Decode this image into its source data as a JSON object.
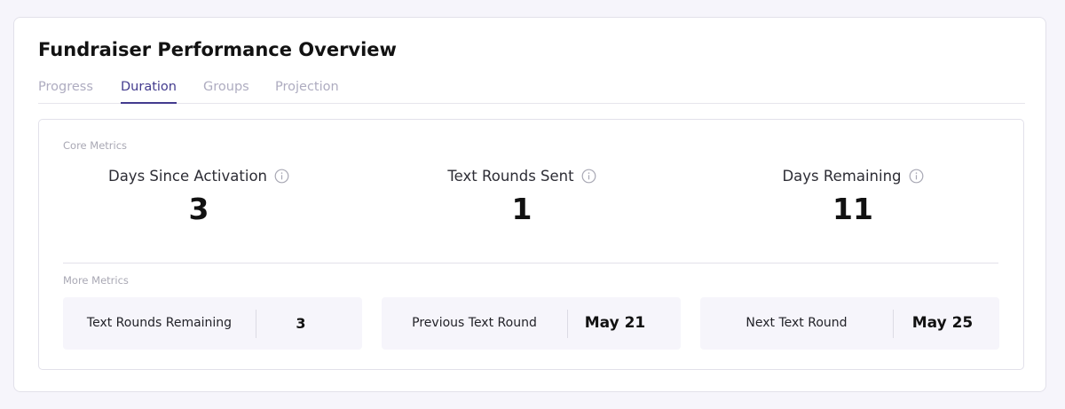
{
  "header": {
    "title": "Fundraiser Performance Overview"
  },
  "tabs": [
    {
      "label": "Progress",
      "active": false
    },
    {
      "label": "Duration",
      "active": true
    },
    {
      "label": "Groups",
      "active": false
    },
    {
      "label": "Projection",
      "active": false
    }
  ],
  "core_metrics": {
    "section_label": "Core Metrics",
    "items": [
      {
        "label": "Days Since Activation",
        "value": "3",
        "icon": "info-icon"
      },
      {
        "label": "Text Rounds Sent",
        "value": "1",
        "icon": "info-icon"
      },
      {
        "label": "Days Remaining",
        "value": "11",
        "icon": "info-icon"
      }
    ]
  },
  "more_metrics": {
    "section_label": "More Metrics",
    "items": [
      {
        "label": "Text Rounds Remaining",
        "value": "3"
      },
      {
        "label": "Previous Text Round",
        "value": "May 21"
      },
      {
        "label": "Next Text Round",
        "value": "May 25"
      }
    ]
  },
  "colors": {
    "accent": "#433b8e",
    "inactive_tab": "#aeacc0",
    "page_background": "#f6f5fb",
    "metric_tile": "#f6f5fb",
    "border": "#e2e1ea"
  }
}
